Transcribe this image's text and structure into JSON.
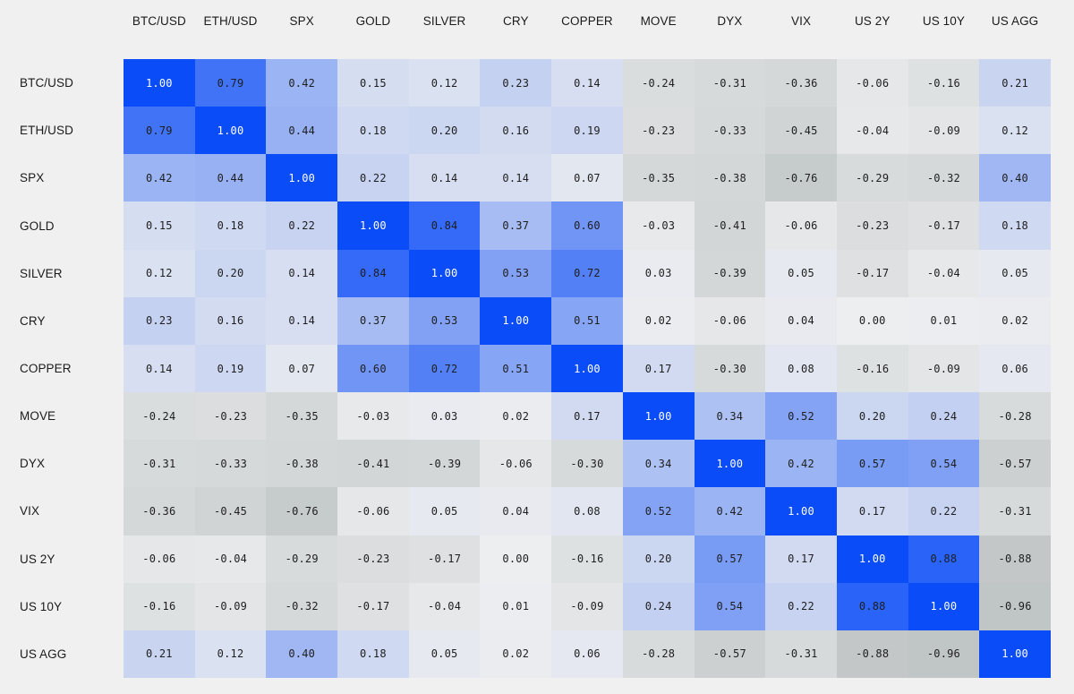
{
  "chart_data": {
    "type": "heatmap",
    "title": "",
    "subtitle": "",
    "xlabel": "",
    "ylabel": "",
    "grid": false,
    "legend": "none",
    "value_format": "2dp",
    "zlim": [
      -1,
      1
    ],
    "colorscale": {
      "negative_end": "#bfc4c4",
      "midpoint": "#edeef0",
      "positive_end": "#0a4cf8",
      "diagonal": "#0a4cf8",
      "diagonal_text": "#ffffff"
    },
    "categories": [
      "BTC/USD",
      "ETH/USD",
      "SPX",
      "GOLD",
      "SILVER",
      "CRY",
      "COPPER",
      "MOVE",
      "DYX",
      "VIX",
      "US 2Y",
      "US 10Y",
      "US AGG"
    ],
    "x_tick_labels": [
      "BTC/USD",
      "ETH/USD",
      "SPX",
      "GOLD",
      "SILVER",
      "CRY",
      "COPPER",
      "MOVE",
      "DYX",
      "VIX",
      "US 2Y",
      "US 10Y",
      "US AGG"
    ],
    "y_tick_labels": [
      "BTC/USD",
      "ETH/USD",
      "SPX",
      "GOLD",
      "SILVER",
      "CRY",
      "COPPER",
      "MOVE",
      "DYX",
      "VIX",
      "US 2Y",
      "US 10Y",
      "US AGG"
    ],
    "values": [
      [
        1.0,
        0.79,
        0.42,
        0.15,
        0.12,
        0.23,
        0.14,
        -0.24,
        -0.31,
        -0.36,
        -0.06,
        -0.16,
        0.21
      ],
      [
        0.79,
        1.0,
        0.44,
        0.18,
        0.2,
        0.16,
        0.19,
        -0.23,
        -0.33,
        -0.45,
        -0.04,
        -0.09,
        0.12
      ],
      [
        0.42,
        0.44,
        1.0,
        0.22,
        0.14,
        0.14,
        0.07,
        -0.35,
        -0.38,
        -0.76,
        -0.29,
        -0.32,
        0.4
      ],
      [
        0.15,
        0.18,
        0.22,
        1.0,
        0.84,
        0.37,
        0.6,
        -0.03,
        -0.41,
        -0.06,
        -0.23,
        -0.17,
        0.18
      ],
      [
        0.12,
        0.2,
        0.14,
        0.84,
        1.0,
        0.53,
        0.72,
        0.03,
        -0.39,
        0.05,
        -0.17,
        -0.04,
        0.05
      ],
      [
        0.23,
        0.16,
        0.14,
        0.37,
        0.53,
        1.0,
        0.51,
        0.02,
        -0.06,
        0.04,
        0.0,
        0.01,
        0.02
      ],
      [
        0.14,
        0.19,
        0.07,
        0.6,
        0.72,
        0.51,
        1.0,
        0.17,
        -0.3,
        0.08,
        -0.16,
        -0.09,
        0.06
      ],
      [
        -0.24,
        -0.23,
        -0.35,
        -0.03,
        0.03,
        0.02,
        0.17,
        1.0,
        0.34,
        0.52,
        0.2,
        0.24,
        -0.28
      ],
      [
        -0.31,
        -0.33,
        -0.38,
        -0.41,
        -0.39,
        -0.06,
        -0.3,
        0.34,
        1.0,
        0.42,
        0.57,
        0.54,
        -0.57
      ],
      [
        -0.36,
        -0.45,
        -0.76,
        -0.06,
        0.05,
        0.04,
        0.08,
        0.52,
        0.42,
        1.0,
        0.17,
        0.22,
        -0.31
      ],
      [
        -0.06,
        -0.04,
        -0.29,
        -0.23,
        -0.17,
        0.0,
        -0.16,
        0.2,
        0.57,
        0.17,
        1.0,
        0.88,
        -0.88
      ],
      [
        -0.16,
        -0.09,
        -0.32,
        -0.17,
        -0.04,
        0.01,
        -0.09,
        0.24,
        0.54,
        0.22,
        0.88,
        1.0,
        -0.96
      ],
      [
        0.21,
        0.12,
        0.4,
        0.18,
        0.05,
        0.02,
        0.06,
        -0.28,
        -0.57,
        -0.31,
        -0.88,
        -0.96,
        1.0
      ]
    ],
    "cell_labels": [
      [
        "1.00",
        "0.79",
        "0.42",
        "0.15",
        "0.12",
        "0.23",
        "0.14",
        "-0.24",
        "-0.31",
        "-0.36",
        "-0.06",
        "-0.16",
        "0.21"
      ],
      [
        "0.79",
        "1.00",
        "0.44",
        "0.18",
        "0.20",
        "0.16",
        "0.19",
        "-0.23",
        "-0.33",
        "-0.45",
        "-0.04",
        "-0.09",
        "0.12"
      ],
      [
        "0.42",
        "0.44",
        "1.00",
        "0.22",
        "0.14",
        "0.14",
        "0.07",
        "-0.35",
        "-0.38",
        "-0.76",
        "-0.29",
        "-0.32",
        "0.40"
      ],
      [
        "0.15",
        "0.18",
        "0.22",
        "1.00",
        "0.84",
        "0.37",
        "0.60",
        "-0.03",
        "-0.41",
        "-0.06",
        "-0.23",
        "-0.17",
        "0.18"
      ],
      [
        "0.12",
        "0.20",
        "0.14",
        "0.84",
        "1.00",
        "0.53",
        "0.72",
        "0.03",
        "-0.39",
        "0.05",
        "-0.17",
        "-0.04",
        "0.05"
      ],
      [
        "0.23",
        "0.16",
        "0.14",
        "0.37",
        "0.53",
        "1.00",
        "0.51",
        "0.02",
        "-0.06",
        "0.04",
        "0.00",
        "0.01",
        "0.02"
      ],
      [
        "0.14",
        "0.19",
        "0.07",
        "0.60",
        "0.72",
        "0.51",
        "1.00",
        "0.17",
        "-0.30",
        "0.08",
        "-0.16",
        "-0.09",
        "0.06"
      ],
      [
        "-0.24",
        "-0.23",
        "-0.35",
        "-0.03",
        "0.03",
        "0.02",
        "0.17",
        "1.00",
        "0.34",
        "0.52",
        "0.20",
        "0.24",
        "-0.28"
      ],
      [
        "-0.31",
        "-0.33",
        "-0.38",
        "-0.41",
        "-0.39",
        "-0.06",
        "-0.30",
        "0.34",
        "1.00",
        "0.42",
        "0.57",
        "0.54",
        "-0.57"
      ],
      [
        "-0.36",
        "-0.45",
        "-0.76",
        "-0.06",
        "0.05",
        "0.04",
        "0.08",
        "0.52",
        "0.42",
        "1.00",
        "0.17",
        "0.22",
        "-0.31"
      ],
      [
        "-0.06",
        "-0.04",
        "-0.29",
        "-0.23",
        "-0.17",
        "0.00",
        "-0.16",
        "0.20",
        "0.57",
        "0.17",
        "1.00",
        "0.88",
        "-0.88"
      ],
      [
        "-0.16",
        "-0.09",
        "-0.32",
        "-0.17",
        "-0.04",
        "0.01",
        "-0.09",
        "0.24",
        "0.54",
        "0.22",
        "0.88",
        "1.00",
        "-0.96"
      ],
      [
        "0.21",
        "0.12",
        "0.40",
        "0.18",
        "0.05",
        "0.02",
        "0.06",
        "-0.28",
        "-0.57",
        "-0.31",
        "-0.88",
        "-0.96",
        "1.00"
      ]
    ]
  }
}
